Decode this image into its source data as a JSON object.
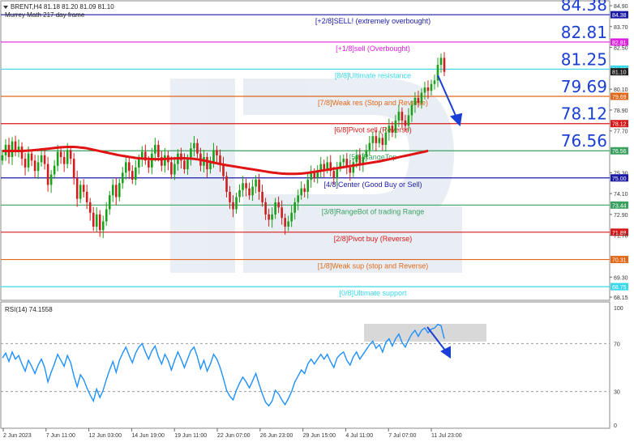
{
  "header": {
    "symbol_line": "BRENT,H4  81.18 81.20 81.09 81.10",
    "indicator_name": "Murrey Math 217 day frame"
  },
  "rsi_panel": {
    "label": "RSI(14) 74.1558",
    "levels": [
      100,
      70,
      30,
      0
    ]
  },
  "colors": {
    "background": "#ffffff",
    "bull_candle": "#1aa01a",
    "bear_candle": "#cc1f1f",
    "ma_line": "#e01414",
    "rsi_line": "#1e90ff",
    "forecast_arrow": "#1a3fd6",
    "big_label": "#1a3fd6"
  },
  "chart_data": [
    {
      "type": "candlestick",
      "title": "",
      "y_range": [
        68.15,
        84.9
      ],
      "y_ticks": [
        "84.90",
        "84.38",
        "83.70",
        "82.81",
        "82.50",
        "81.25",
        "80.10",
        "79.69",
        "78.90",
        "78.12",
        "77.70",
        "76.56",
        "75.30",
        "75.00",
        "74.10",
        "73.44",
        "72.90",
        "71.88",
        "71.70",
        "70.31",
        "69.30",
        "68.75",
        "68.15"
      ],
      "x_tick_labels": [
        "2 Jun 2023",
        "7 Jun 11:00",
        "12 Jun 03:00",
        "14 Jun 19:00",
        "19 Jun 11:00",
        "22 Jun 07:00",
        "26 Jun 23:00",
        "29 Jun 15:00",
        "4 Jul 11:00",
        "7 Jul 07:00",
        "11 Jul 23:00"
      ],
      "murrey_levels": [
        {
          "value": 84.38,
          "label": "[+2/8]SELL! (extremely overbought)",
          "color": "#1a1aa6",
          "tag": "84.38"
        },
        {
          "value": 82.81,
          "label": "[+1/8]sell (Overbought)",
          "color": "#e020e0",
          "tag": "82.81"
        },
        {
          "value": 81.25,
          "label": "[8/8]Ultimate resistance",
          "color": "#38d8e8",
          "tag": "81.25"
        },
        {
          "value": 79.69,
          "label": "[7/8]Weak res (Stop and Reverse)",
          "color": "#e06818",
          "tag": "79.69"
        },
        {
          "value": 78.12,
          "label": "[6/8]Pivot sell (Reverse)",
          "color": "#d81818",
          "tag": "78.12"
        },
        {
          "value": 76.56,
          "label": "[5/8]RangeTop",
          "color": "#3aa060",
          "tag": "76.56"
        },
        {
          "value": 75.0,
          "label": "[4/8]Center (Good Buy or Sell)",
          "color": "#1a1aa6",
          "tag": "75.00"
        },
        {
          "value": 73.44,
          "label": "[3/8]RangeBot of trading Range",
          "color": "#3aa060",
          "tag": "73.44"
        },
        {
          "value": 71.88,
          "label": "[2/8]Pivot buy (Reverse)",
          "color": "#d81818",
          "tag": "71.88"
        },
        {
          "value": 70.31,
          "label": "[1/8]Weak sup (stop and Reverse)",
          "color": "#e06818",
          "tag": "70.31"
        },
        {
          "value": 68.75,
          "label": "[0/8]Ultimate support",
          "color": "#38d8e8",
          "tag": "68.75"
        }
      ],
      "big_level_labels": [
        "84.38",
        "82.81",
        "81.25",
        "79.69",
        "78.12",
        "76.56"
      ],
      "current_price": "81.10",
      "series": [
        {
          "name": "Price",
          "values": [
            76.3,
            76.9,
            76.2,
            77.1,
            76.5,
            76.8,
            76.1,
            75.6,
            76.4,
            76.0,
            75.4,
            75.9,
            76.3,
            75.8,
            74.6,
            75.2,
            75.7,
            76.5,
            76.2,
            75.8,
            76.6,
            76.1,
            75.0,
            73.8,
            74.6,
            74.2,
            73.6,
            73.0,
            72.2,
            72.9,
            72.0,
            72.5,
            73.2,
            74.0,
            74.6,
            73.9,
            74.7,
            75.3,
            75.9,
            75.4,
            74.9,
            75.6,
            76.1,
            76.5,
            76.0,
            75.6,
            76.4,
            76.9,
            76.2,
            75.7,
            76.3,
            75.9,
            75.2,
            75.8,
            76.4,
            76.0,
            75.5,
            76.1,
            76.7,
            77.0,
            76.4,
            75.7,
            76.2,
            75.5,
            75.9,
            76.6,
            76.3,
            75.8,
            75.1,
            74.2,
            73.6,
            73.2,
            73.9,
            74.3,
            74.7,
            74.4,
            74.0,
            74.5,
            74.9,
            74.2,
            73.6,
            72.9,
            72.6,
            72.9,
            73.6,
            73.3,
            72.7,
            72.2,
            72.5,
            73.0,
            73.6,
            74.0,
            74.4,
            74.2,
            74.9,
            75.3,
            75.0,
            75.4,
            75.8,
            75.5,
            75.9,
            75.4,
            75.0,
            75.6,
            75.9,
            76.1,
            75.6,
            75.3,
            75.9,
            76.3,
            75.8,
            76.2,
            76.6,
            77.0,
            77.4,
            77.0,
            77.3,
            76.9,
            77.6,
            78.0,
            77.6,
            78.3,
            78.8,
            78.3,
            78.0,
            78.6,
            79.2,
            79.6,
            79.3,
            79.9,
            80.2,
            80.0,
            80.4,
            80.6,
            81.5,
            81.9,
            81.1
          ]
        },
        {
          "name": "MA",
          "values": [
            76.55,
            76.55,
            76.55,
            76.55,
            76.55,
            76.55,
            76.55,
            76.56,
            76.57,
            76.58,
            76.6,
            76.62,
            76.64,
            76.66,
            76.68,
            76.7,
            76.72,
            76.74,
            76.76,
            76.77,
            76.78,
            76.78,
            76.78,
            76.77,
            76.75,
            76.73,
            76.7,
            76.66,
            76.62,
            76.58,
            76.54,
            76.5,
            76.46,
            76.42,
            76.38,
            76.34,
            76.3,
            76.27,
            76.24,
            76.21,
            76.18,
            76.15,
            76.13,
            76.11,
            76.1,
            76.09,
            76.08,
            76.08,
            76.08,
            76.08,
            76.09,
            76.1,
            76.11,
            76.12,
            76.13,
            76.13,
            76.13,
            76.12,
            76.11,
            76.09,
            76.07,
            76.04,
            76.0,
            75.96,
            75.92,
            75.88,
            75.84,
            75.8,
            75.76,
            75.73,
            75.7,
            75.67,
            75.64,
            75.61,
            75.58,
            75.55,
            75.52,
            75.49,
            75.46,
            75.43,
            75.4,
            75.37,
            75.34,
            75.31,
            75.29,
            75.27,
            75.25,
            75.24,
            75.23,
            75.23,
            75.23,
            75.24,
            75.25,
            75.27,
            75.29,
            75.32,
            75.35,
            75.38,
            75.41,
            75.44,
            75.47,
            75.5,
            75.53,
            75.56,
            75.59,
            75.62,
            75.65,
            75.68,
            75.71,
            75.74,
            75.77,
            75.8,
            75.83,
            75.86,
            75.89,
            75.92,
            75.95,
            75.99,
            76.03,
            76.07,
            76.11,
            76.15,
            76.19,
            76.23,
            76.27,
            76.31,
            76.35,
            76.39,
            76.43,
            76.47,
            76.51,
            76.56
          ]
        }
      ]
    },
    {
      "type": "line",
      "title": "RSI(14) 74.1558",
      "y_range": [
        0,
        100
      ],
      "y_ticks": [
        "100",
        "70",
        "30",
        "0"
      ],
      "series": [
        {
          "name": "RSI(14)",
          "values": [
            58,
            62,
            55,
            63,
            57,
            60,
            53,
            47,
            56,
            51,
            45,
            52,
            57,
            50,
            38,
            46,
            53,
            61,
            56,
            51,
            60,
            54,
            43,
            34,
            44,
            40,
            33,
            27,
            22,
            32,
            25,
            31,
            40,
            48,
            55,
            46,
            56,
            62,
            67,
            60,
            54,
            62,
            67,
            70,
            63,
            57,
            64,
            68,
            59,
            53,
            61,
            56,
            48,
            56,
            63,
            57,
            50,
            57,
            64,
            67,
            59,
            49,
            56,
            47,
            53,
            61,
            57,
            50,
            41,
            31,
            26,
            23,
            31,
            37,
            42,
            38,
            33,
            39,
            45,
            36,
            28,
            21,
            18,
            22,
            31,
            28,
            23,
            19,
            24,
            30,
            38,
            43,
            48,
            45,
            53,
            57,
            53,
            57,
            61,
            57,
            61,
            55,
            50,
            58,
            61,
            63,
            56,
            52,
            59,
            63,
            57,
            61,
            65,
            69,
            72,
            66,
            69,
            63,
            71,
            74,
            68,
            74,
            78,
            71,
            67,
            73,
            78,
            81,
            76,
            81,
            83,
            79,
            82,
            83,
            86,
            85,
            74
          ]
        }
      ]
    }
  ],
  "annotations": {
    "shaded_zone_rsi": [
      70,
      88
    ],
    "forecast_arrows": 2
  }
}
